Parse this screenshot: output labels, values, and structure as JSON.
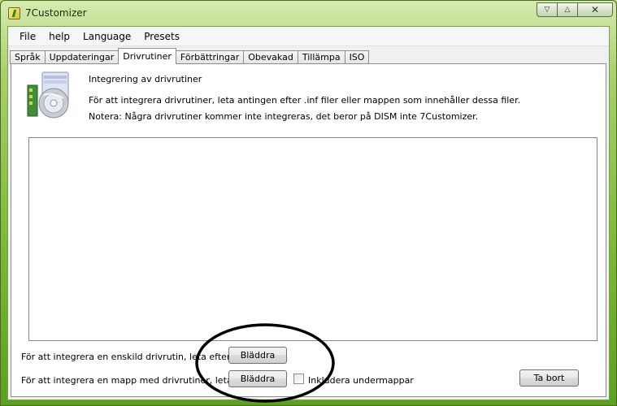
{
  "window": {
    "title": "7Customizer",
    "minimize_glyph": "▽",
    "maximize_glyph": "△",
    "close_glyph": "✕"
  },
  "menu": {
    "items": [
      "File",
      "help",
      "Language",
      "Presets"
    ]
  },
  "tabs": [
    {
      "label": "Språk",
      "active": false
    },
    {
      "label": "Uppdateringar",
      "active": false
    },
    {
      "label": "Drivrutiner",
      "active": true
    },
    {
      "label": "Förbättringar",
      "active": false
    },
    {
      "label": "Obevakad",
      "active": false
    },
    {
      "label": "Tillämpa",
      "active": false
    },
    {
      "label": "ISO",
      "active": false
    }
  ],
  "panel": {
    "heading": "Integrering av drivrutiner",
    "description": "För att integrera drivrutiner, leta antingen efter .inf filer eller mappen som innehåller dessa filer.",
    "note": "Notera: Några drivrutiner kommer inte integreras, det beror på DISM inte 7Customizer."
  },
  "single_driver": {
    "label": "För att integrera en enskild drivrutin, leta efter .inf filen:",
    "browse_label": "Bläddra"
  },
  "folder_driver": {
    "label": "För att integrera en mapp med drivrutiner, leta efter den:",
    "browse_label": "Bläddra",
    "include_subfolders_label": "Inkludera undermappar",
    "include_subfolders_checked": false
  },
  "remove_button_label": "Ta bort",
  "icons": {
    "app": "7customizer-app-icon",
    "driver": "driver-hardware-icon"
  }
}
